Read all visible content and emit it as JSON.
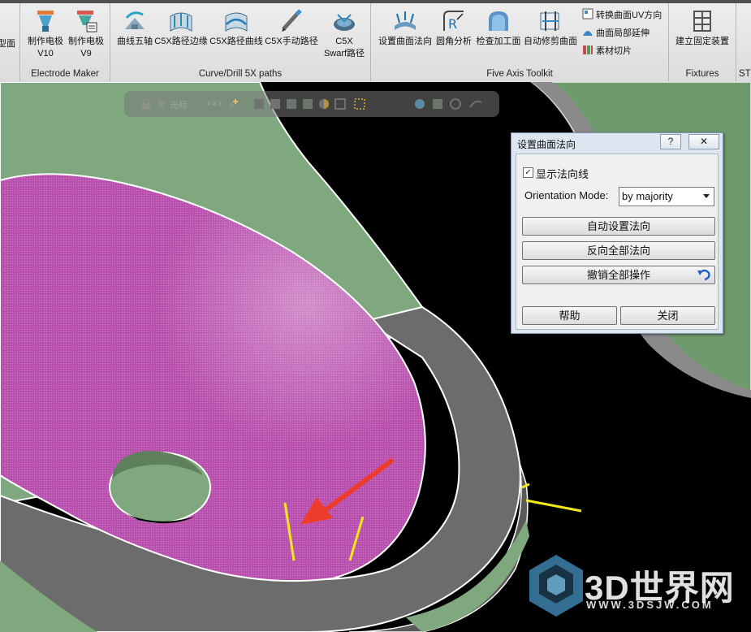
{
  "ribbon": {
    "partial_left_label": "型面",
    "groups": [
      {
        "label": "Electrode Maker",
        "buttons": [
          {
            "label_line1": "制作电极",
            "label_line2": "V10",
            "icon": "electrode-v10-icon"
          },
          {
            "label_line1": "制作电极",
            "label_line2": "V9",
            "icon": "electrode-v9-icon"
          }
        ]
      },
      {
        "label": "Curve/Drill 5X paths",
        "buttons": [
          {
            "label_line1": "曲线五轴",
            "icon": "curve-5axis-icon"
          },
          {
            "label_line1": "C5X路径边缘",
            "icon": "c5x-edge-path-icon"
          },
          {
            "label_line1": "C5X路径曲线",
            "icon": "c5x-curve-path-icon"
          },
          {
            "label_line1": "C5X手动路径",
            "icon": "c5x-manual-path-icon"
          },
          {
            "label_line1": "C5X",
            "label_line2": "Swarf路径",
            "icon": "c5x-swarf-icon"
          }
        ]
      },
      {
        "label": "Five Axis Toolkit",
        "buttons": [
          {
            "label_line1": "设置曲面法向",
            "icon": "surface-normal-icon"
          },
          {
            "label_line1": "圆角分析",
            "icon": "fillet-analysis-icon"
          },
          {
            "label_line1": "检查加工面",
            "icon": "check-surface-icon"
          },
          {
            "label_line1": "自动修剪曲面",
            "icon": "auto-trim-icon"
          }
        ],
        "small_buttons": [
          {
            "label": "转换曲面UV方向",
            "icon": "uv-direction-icon"
          },
          {
            "label": "曲面局部延伸",
            "icon": "surface-extend-icon"
          },
          {
            "label": "素材切片",
            "icon": "stock-slice-icon"
          }
        ]
      },
      {
        "label": "Fixtures",
        "buttons": [
          {
            "label_line1": "建立固定装置",
            "icon": "fixture-icon"
          }
        ]
      },
      {
        "label": "ST"
      }
    ]
  },
  "quickbar": {
    "cursor_label": "光标",
    "xyz_label": "x x z"
  },
  "dialog": {
    "title": "设置曲面法向",
    "help_glyph": "?",
    "close_glyph": "✕",
    "show_normals_label": "显示法向线",
    "show_normals_checked": true,
    "check_glyph": "✓",
    "orientation_label": "Orientation Mode:",
    "orientation_value": "by majority",
    "auto_set_button": "自动设置法向",
    "reverse_all_button": "反向全部法向",
    "undo_all_button": "撤销全部操作",
    "help_button": "帮助",
    "close_button": "关闭"
  },
  "watermark": {
    "brand": "3D世界网",
    "url": "WWW.3DSJW.COM"
  },
  "colors": {
    "surface_magenta": "#b94fae",
    "surface_green": "#7fa87e",
    "surface_gray": "#6c6c6c",
    "normal_lines": "#f0e41a",
    "arrow_red": "#ee3c2c"
  }
}
